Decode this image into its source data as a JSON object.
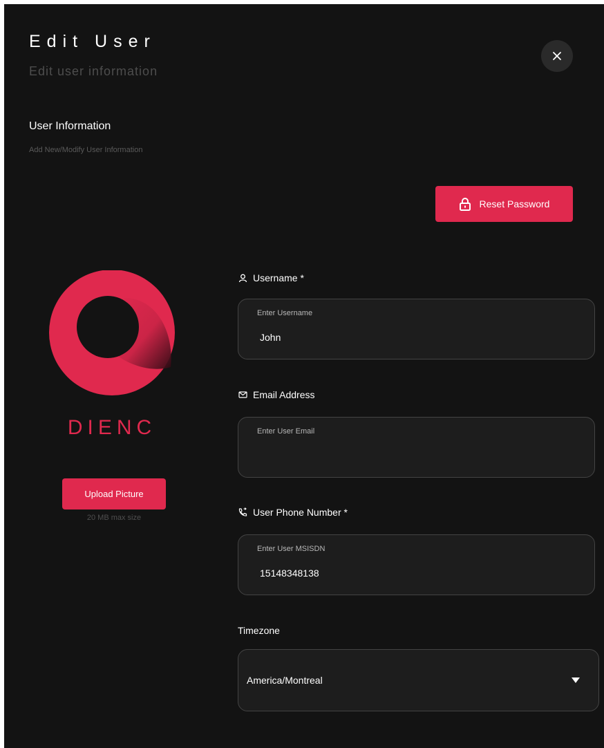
{
  "header": {
    "title": "Edit User",
    "subtitle": "Edit user information"
  },
  "section": {
    "title": "User Information",
    "subtitle": "Add New/Modify User Information"
  },
  "actions": {
    "reset_password_label": "Reset Password",
    "upload_picture_label": "Upload Picture",
    "upload_hint": "20 MB max size"
  },
  "logo": {
    "text": "DIENC",
    "colors": {
      "accent": "#e0294e",
      "dark": "#131313"
    }
  },
  "fields": {
    "username": {
      "label": "Username *",
      "placeholder": "Enter Username",
      "value": "John",
      "icon": "user-icon"
    },
    "email": {
      "label": "Email Address",
      "placeholder": "Enter User Email",
      "value": "",
      "icon": "envelope-icon"
    },
    "phone": {
      "label": "User Phone Number *",
      "placeholder": "Enter User MSISDN",
      "value": "15148348138",
      "icon": "phone-icon"
    },
    "timezone": {
      "label": "Timezone",
      "value": "America/Montreal",
      "icon": "caret-down-icon"
    }
  },
  "colors": {
    "background": "#131313",
    "accent": "#e0294e",
    "field_background": "#1d1d1d",
    "field_border": "#444444",
    "muted_text": "#4d4d4d"
  }
}
